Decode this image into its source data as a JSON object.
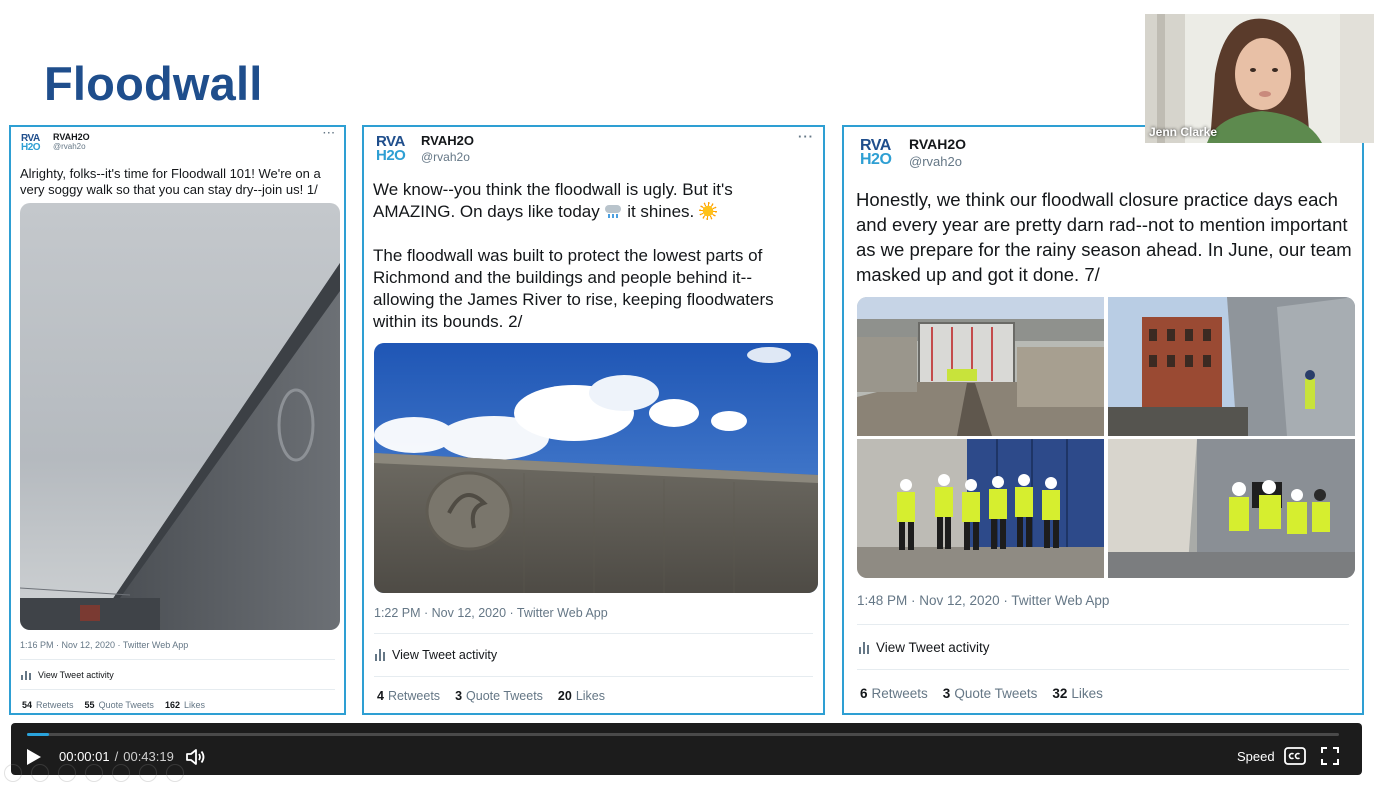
{
  "slide": {
    "title": "Floodwall"
  },
  "tweets": [
    {
      "logo_line1": "RVA",
      "logo_line2": "H2O",
      "name": "RVAH2O",
      "handle": "@rvah2o",
      "more": "···",
      "text": "Alrighty, folks--it's time for Floodwall 101! We're on a very soggy walk so that you can stay dry--join us! 1/",
      "meta": "1:16 PM · Nov 12, 2020 · Twitter Web App",
      "activity": "View Tweet activity",
      "retweets": "54",
      "retweets_label": "Retweets",
      "quotes": "55",
      "quotes_label": "Quote Tweets",
      "likes": "162",
      "likes_label": "Likes"
    },
    {
      "logo_line1": "RVA",
      "logo_line2": "H2O",
      "name": "RVAH2O",
      "handle": "@rvah2o",
      "more": "···",
      "text_a": "We know--you think the floodwall is ugly. But it's AMAZING. On days like today ",
      "text_b": " it shines. ",
      "text_c": "The floodwall was built to protect the lowest parts of Richmond and the buildings and people behind it--allowing the James River to rise, keeping floodwaters within its bounds. 2/",
      "meta": "1:22 PM · Nov 12, 2020 · Twitter Web App",
      "activity": "View Tweet activity",
      "retweets": "4",
      "retweets_label": "Retweets",
      "quotes": "3",
      "quotes_label": "Quote Tweets",
      "likes": "20",
      "likes_label": "Likes"
    },
    {
      "logo_line1": "RVA",
      "logo_line2": "H2O",
      "name": "RVAH2O",
      "handle": "@rvah2o",
      "text": "Honestly, we think our floodwall closure practice days each and every year are pretty darn rad--not to mention important as we prepare for the rainy season ahead. In June, our team masked up and got it done. 7/",
      "meta": "1:48 PM · Nov 12, 2020 · Twitter Web App",
      "activity": "View Tweet activity",
      "retweets": "6",
      "retweets_label": "Retweets",
      "quotes": "3",
      "quotes_label": "Quote Tweets",
      "likes": "32",
      "likes_label": "Likes"
    }
  ],
  "webcam": {
    "participant_name": "Jenn Clarke"
  },
  "player": {
    "current_time": "00:00:01",
    "separator": "/",
    "duration": "00:43:19",
    "progress_fraction": 0.017,
    "speed_label": "Speed",
    "accent": "#2aa3dc"
  },
  "colors": {
    "title": "#1f4e8c",
    "tweet_border": "#2e9fd3",
    "player_bg": "#1c1c1c"
  }
}
